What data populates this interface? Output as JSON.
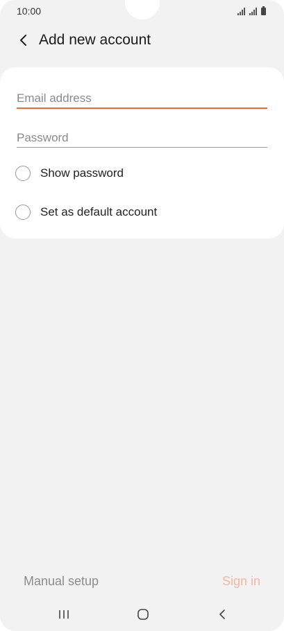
{
  "status_bar": {
    "time": "10:00"
  },
  "header": {
    "back_icon": "chevron-left-icon",
    "title": "Add new account"
  },
  "form": {
    "email": {
      "value": "",
      "placeholder": "Email address"
    },
    "password": {
      "value": "",
      "placeholder": "Password"
    },
    "show_password": {
      "label": "Show password",
      "checked": false
    },
    "default_account": {
      "label": "Set as default account",
      "checked": false
    }
  },
  "actions": {
    "manual_setup": "Manual setup",
    "sign_in": "Sign in"
  },
  "nav": {
    "recents_icon": "recents-icon",
    "home_icon": "home-icon",
    "back_icon": "back-icon"
  },
  "colors": {
    "accent": "#ec6a2e",
    "sign_in_disabled": "#f6b6a0",
    "background": "#f2f2f2",
    "card": "#ffffff"
  }
}
